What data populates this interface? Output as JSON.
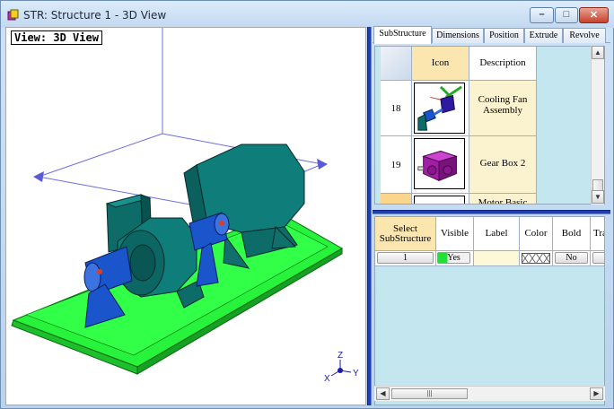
{
  "window": {
    "title": "STR: Structure 1 - 3D View",
    "buttons": {
      "minimize": "–",
      "maximize": "□",
      "close": "✕"
    }
  },
  "viewport": {
    "label": "View: 3D View",
    "axes": {
      "z": "Z",
      "x": "X",
      "y": "Y"
    }
  },
  "tabs": [
    {
      "label": "SubStructure",
      "active": true
    },
    {
      "label": "Dimensions"
    },
    {
      "label": "Position"
    },
    {
      "label": "Extrude"
    },
    {
      "label": "Revolve"
    }
  ],
  "substructure_grid": {
    "columns": [
      "Icon",
      "Description"
    ],
    "rows": [
      {
        "number": "18",
        "description": "Cooling Fan Assembly",
        "icon": "cooling-fan-icon"
      },
      {
        "number": "19",
        "description": "Gear Box 2",
        "icon": "gear-box-icon"
      },
      {
        "number": "",
        "description": "Motor Basic",
        "icon": "motor-icon"
      }
    ]
  },
  "properties_grid": {
    "columns": [
      "Select SubStructure",
      "Visible",
      "Label",
      "Color",
      "Bold",
      "Tra"
    ],
    "row": {
      "select": "1",
      "visible": "Yes",
      "label": "",
      "color": "",
      "bold": "No",
      "tra": ""
    }
  },
  "colors": {
    "accent_splitter": "#1f3fb0",
    "grid_bg": "#c4e6ee",
    "selected_header": "#fbe6b0",
    "base_green": "#26f03a",
    "machine_teal": "#0d6b68",
    "shaft_blue": "#1a55cc"
  }
}
